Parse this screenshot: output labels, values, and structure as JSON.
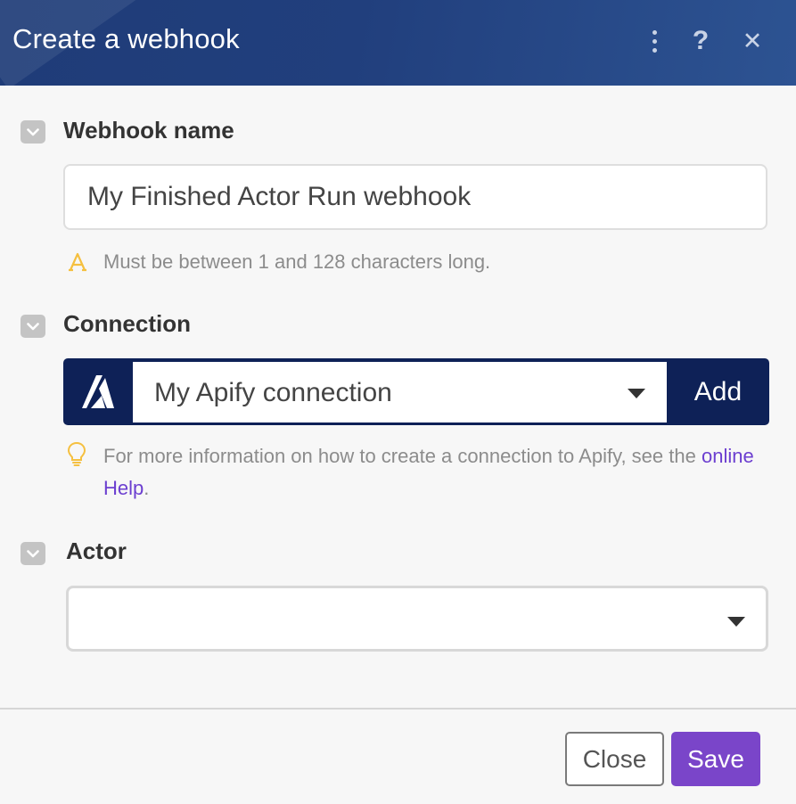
{
  "header": {
    "title": "Create a webhook",
    "help_glyph": "?",
    "close_glyph": "✕"
  },
  "webhook_name": {
    "label": "Webhook name",
    "value": "My Finished Actor Run webhook",
    "hint": "Must be between 1 and 128 characters long."
  },
  "connection": {
    "label": "Connection",
    "selected": "My Apify connection",
    "add_label": "Add",
    "hint_before": "For more information on how to create a connection to Apify, see the ",
    "hint_link": "online Help",
    "hint_after": "."
  },
  "actor": {
    "label": "Actor",
    "selected": ""
  },
  "footer": {
    "close_label": "Close",
    "save_label": "Save"
  },
  "icons": {
    "more": "more-vertical-icon",
    "help": "help-icon",
    "close": "close-icon",
    "section_toggle": "chevron-down-icon",
    "warning": "text-warning-icon",
    "tip": "lightbulb-icon",
    "apify_logo": "apify-logo-icon",
    "dropdown": "caret-down-icon"
  },
  "colors": {
    "header_bg": "#213f7d",
    "connection_bg": "#0e2157",
    "save_button": "#7a45c9",
    "link": "#6c3fd0",
    "warning_icon": "#f5c040"
  }
}
